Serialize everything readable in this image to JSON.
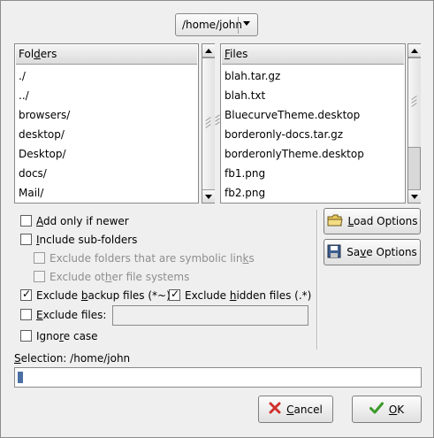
{
  "path_selector": {
    "value": "/home/john"
  },
  "folders": {
    "header": "Folders",
    "items": [
      "./",
      "../",
      "browsers/",
      "desktop/",
      "Desktop/",
      "docs/",
      "Mail/"
    ]
  },
  "files": {
    "header": "Files",
    "items": [
      "blah.tar.gz",
      "blah.txt",
      "BluecurveTheme.desktop",
      "borderonly-docs.tar.gz",
      "borderonlyTheme.desktop",
      "fb1.png",
      "fb2.png"
    ]
  },
  "options": {
    "add_only_if_newer": {
      "pre": "",
      "key": "A",
      "post": "dd only if newer",
      "checked": false
    },
    "include_sub_folders": {
      "pre": "",
      "key": "I",
      "post": "nclude sub-folders",
      "checked": false
    },
    "exclude_symbolic": {
      "pre": "Exclude folders that are symbolic lin",
      "key": "k",
      "post": "s",
      "checked": false
    },
    "exclude_other_fs": {
      "pre": "Exclude ot",
      "key": "h",
      "post": "er file systems",
      "checked": false
    },
    "exclude_backup": {
      "pre": "Exclude ",
      "key": "b",
      "post": "ackup files (*~)",
      "checked": true
    },
    "exclude_hidden": {
      "pre": "Exclude ",
      "key": "h",
      "post": "idden files (.*)",
      "checked": true
    },
    "exclude_files": {
      "pre": "",
      "key": "E",
      "post": "xclude files:",
      "checked": false,
      "value": ""
    },
    "ignore_case": {
      "pre": "Igno",
      "key": "r",
      "post": "e case",
      "checked": false
    }
  },
  "buttons": {
    "load": {
      "key": "L",
      "post": "oad Options"
    },
    "save": {
      "pre": "Sa",
      "key": "v",
      "post": "e Options"
    },
    "cancel": {
      "key": "C",
      "post": "ancel"
    },
    "ok": {
      "key": "O",
      "post": "K"
    }
  },
  "selection": {
    "label_key": "S",
    "label_post": "election: /home/john",
    "value": ""
  },
  "colors": {
    "cancel_x": "#d0312d",
    "ok_check": "#3a9a2a",
    "folder": "#e8c75a"
  }
}
